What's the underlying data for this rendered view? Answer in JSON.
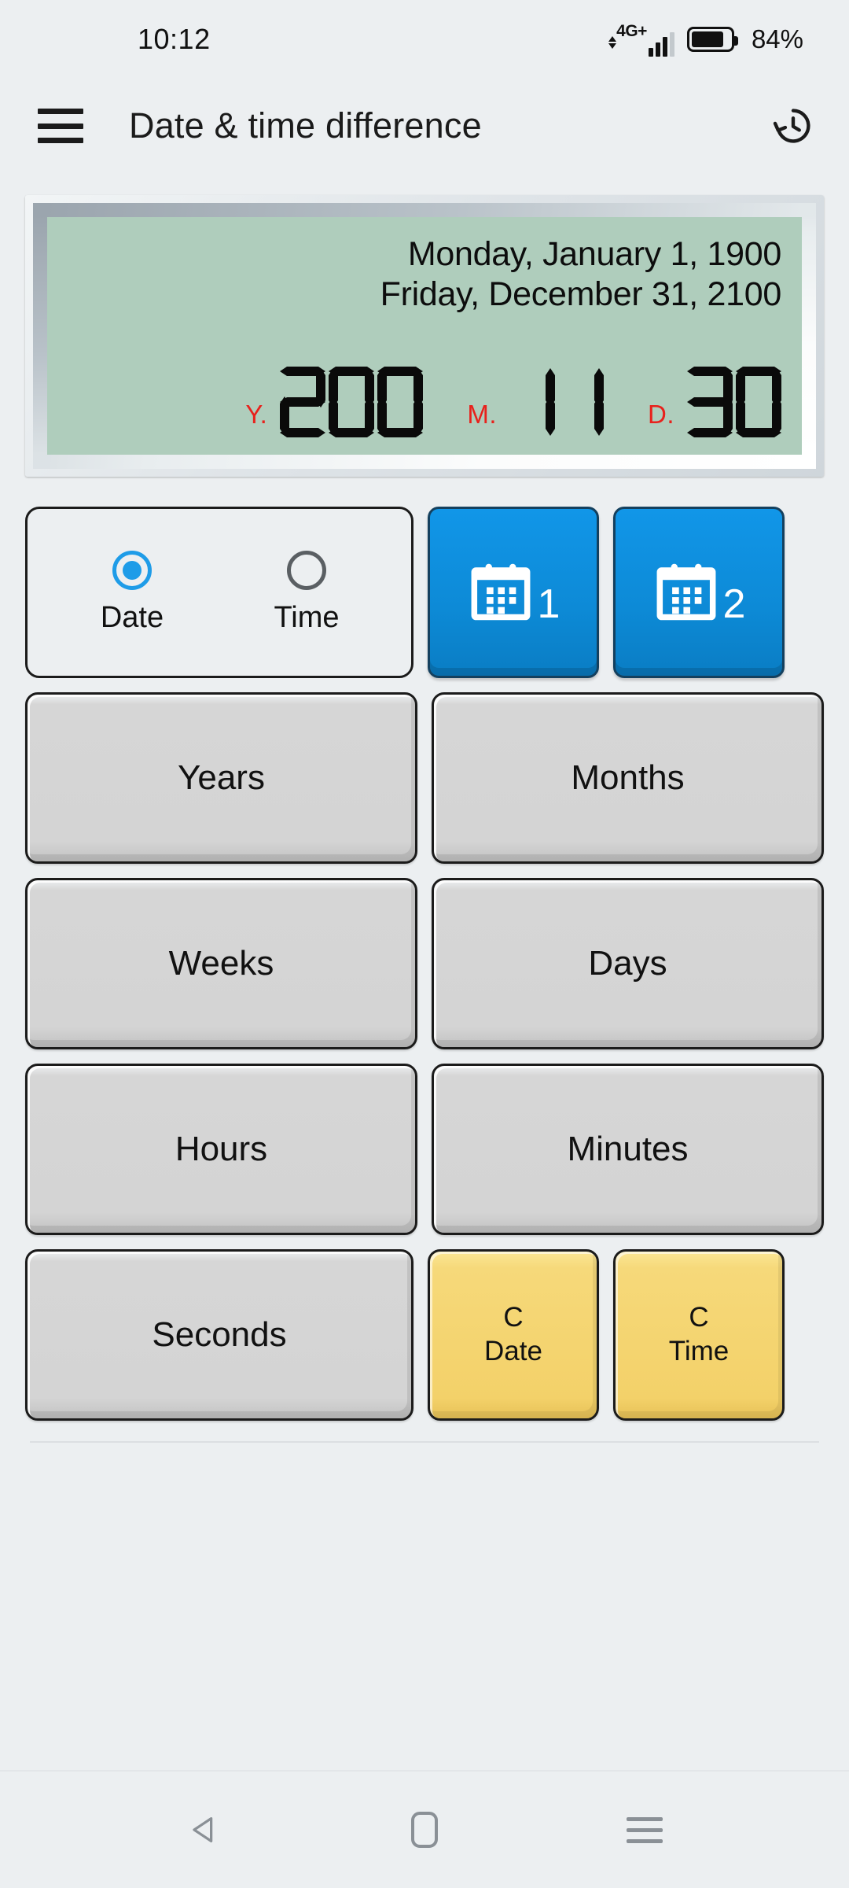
{
  "status_bar": {
    "time": "10:12",
    "network_type": "4G+",
    "battery_percent": "84%",
    "battery_level": 84,
    "signal_icon": "signal-bars-icon",
    "battery_icon": "battery-icon"
  },
  "app_bar": {
    "menu_icon": "hamburger-menu-icon",
    "title": "Date & time difference",
    "history_icon": "history-icon"
  },
  "display": {
    "line1": "Monday, January 1, 1900",
    "line2": "Friday, December 31, 2100",
    "segments": [
      {
        "label": "Y.",
        "value": "200",
        "label_color": "#e8211c"
      },
      {
        "label": "M.",
        "value": "11",
        "label_color": "#e8211c"
      },
      {
        "label": "D.",
        "value": "30",
        "label_color": "#e8211c"
      }
    ],
    "lcd_color": "#afcdbc"
  },
  "mode_selector": {
    "options": [
      {
        "label": "Date",
        "selected": true
      },
      {
        "label": "Time",
        "selected": false
      }
    ],
    "accent_color": "#1e9ce8"
  },
  "calendar_buttons": [
    {
      "icon": "calendar-icon",
      "number": "1",
      "color": "#0d8ad6"
    },
    {
      "icon": "calendar-icon",
      "number": "2",
      "color": "#0d8ad6"
    }
  ],
  "unit_keys": [
    {
      "label": "Years"
    },
    {
      "label": "Months"
    },
    {
      "label": "Weeks"
    },
    {
      "label": "Days"
    },
    {
      "label": "Hours"
    },
    {
      "label": "Minutes"
    },
    {
      "label": "Seconds"
    }
  ],
  "clear_keys": [
    {
      "line1": "C",
      "line2": "Date",
      "color": "#f3d169"
    },
    {
      "line1": "C",
      "line2": "Time",
      "color": "#f3d169"
    }
  ],
  "nav_bar": {
    "back_icon": "back-triangle-icon",
    "home_icon": "home-square-icon",
    "recents_icon": "recents-lines-icon"
  }
}
